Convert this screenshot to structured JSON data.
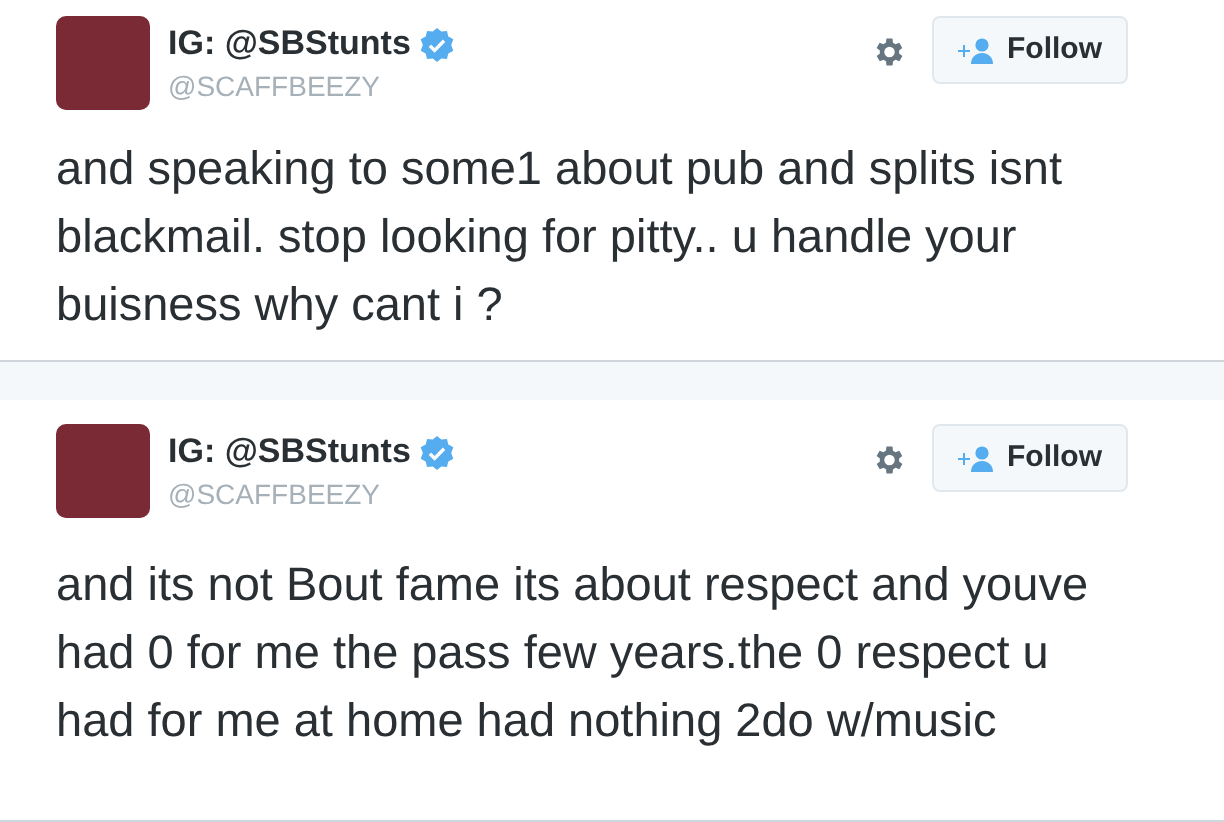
{
  "tweets": [
    {
      "name": "IG: @SBStunts",
      "verified": true,
      "handle": "@SCAFFBEEZY",
      "follow": "Follow",
      "text": "and speaking to some1 about pub and splits isnt blackmail. stop looking for pitty.. u handle your buisness why cant i ?"
    },
    {
      "name": "IG: @SBStunts",
      "verified": true,
      "handle": "@SCAFFBEEZY",
      "follow": "Follow",
      "text": "and its not Bout fame its about respect and youve had 0 for me the pass few years.the 0 respect u had for me at home had nothing 2do w/music"
    }
  ]
}
